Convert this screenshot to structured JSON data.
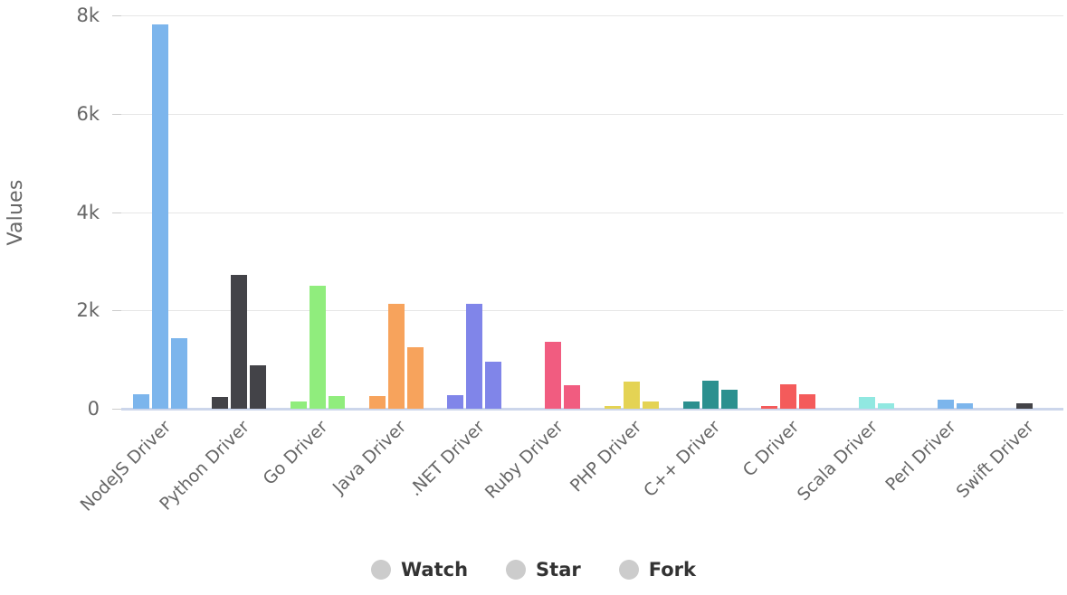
{
  "chart_data": {
    "type": "bar",
    "title": "",
    "subtitle": "",
    "xlabel": "",
    "ylabel": "Values",
    "ylim": [
      0,
      8000
    ],
    "yticks": [
      0,
      2000,
      4000,
      6000,
      8000
    ],
    "ytick_labels": [
      "0",
      "2k",
      "4k",
      "6k",
      "8k"
    ],
    "grid": true,
    "legend_position": "bottom",
    "categories": [
      "NodeJS Driver",
      "Python Driver",
      "Go Driver",
      "Java Driver",
      ".NET Driver",
      "Ruby Driver",
      "PHP Driver",
      "C++ Driver",
      "C Driver",
      "Scala Driver",
      "Perl Driver",
      "Swift Driver"
    ],
    "series": [
      {
        "name": "Watch",
        "values": [
          290,
          240,
          140,
          250,
          280,
          0,
          60,
          140,
          50,
          0,
          0,
          0
        ]
      },
      {
        "name": "Star",
        "values": [
          7820,
          2720,
          2500,
          2140,
          2140,
          1370,
          550,
          570,
          500,
          240,
          180,
          110
        ]
      },
      {
        "name": "Fork",
        "values": [
          1440,
          880,
          250,
          1250,
          950,
          470,
          140,
          390,
          290,
          110,
          110,
          0
        ]
      }
    ],
    "category_colors": [
      "#7cb5ec",
      "#434348",
      "#90ed7d",
      "#f7a35c",
      "#8085e9",
      "#f15c80",
      "#e4d354",
      "#2b908f",
      "#f45b5b",
      "#91e8e1",
      "#7cb5ec",
      "#434348"
    ],
    "legend_marker_color": "#cccccc",
    "gridline_color": "#e6e6e6",
    "baseline_color": "#ccd6eb",
    "axis_text_color": "#666666",
    "legend_text_color": "#333333",
    "background_color": "#ffffff"
  },
  "legend": {
    "items": [
      {
        "label": "Watch"
      },
      {
        "label": "Star"
      },
      {
        "label": "Fork"
      }
    ]
  }
}
